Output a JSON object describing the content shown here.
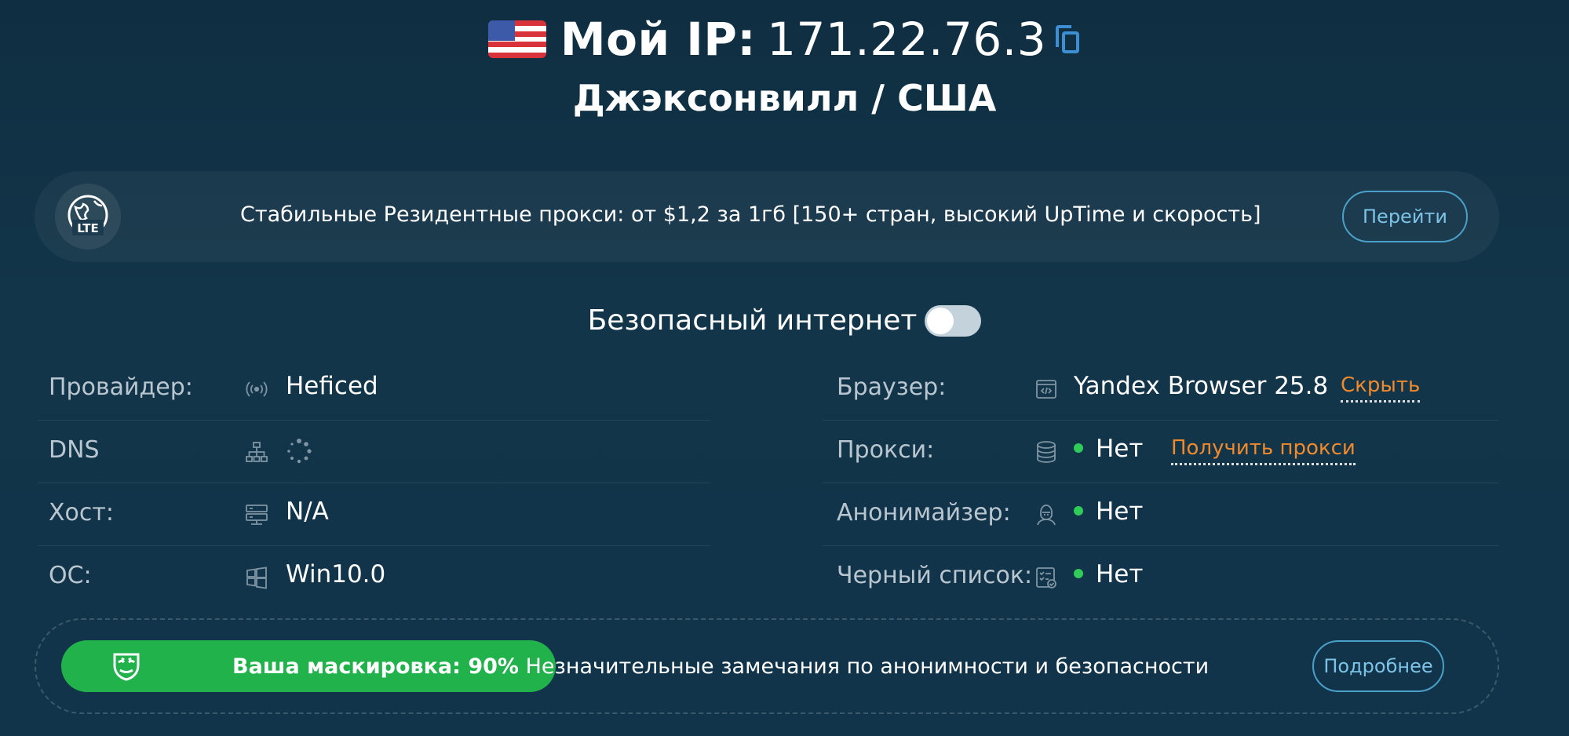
{
  "header": {
    "ip_label": "Мой IP:",
    "ip_value": "171.22.76.3",
    "city": "Джэксонвилл / США"
  },
  "promo": {
    "badge": "LTE",
    "text": "Стабильные Резидентные прокси: от $1,2 за 1гб [150+ стран, высокий UpTime и скорость]",
    "button": "Перейти"
  },
  "safe_internet": {
    "label": "Безопасный интернет",
    "enabled": false
  },
  "left_info": [
    {
      "label": "Провайдер:",
      "value": "Heficed",
      "icon": "signal-icon"
    },
    {
      "label": "DNS",
      "value": "",
      "icon": "network-icon"
    },
    {
      "label": "Хост:",
      "value": "N/A",
      "icon": "server-icon"
    },
    {
      "label": "ОС:",
      "value": "Win10.0",
      "icon": "windows-icon"
    }
  ],
  "right_info": [
    {
      "label": "Браузер:",
      "value": "Yandex Browser 25.8",
      "icon": "browser-code-icon",
      "link": "Скрыть"
    },
    {
      "label": "Прокси:",
      "value": "Нет",
      "icon": "database-icon",
      "link": "Получить прокси"
    },
    {
      "label": "Анонимайзер:",
      "value": "Нет",
      "icon": "hacker-icon"
    },
    {
      "label": "Черный список:",
      "value": "Нет",
      "icon": "checklist-icon"
    }
  ],
  "masking": {
    "label": "Ваша маскировка: 90%",
    "percent": 90,
    "description": "Незначительные замечания по анонимности и безопасности",
    "button": "Подробнее"
  },
  "colors": {
    "accent_green": "#22b24c",
    "status_dot": "#2fcc5a",
    "link_orange": "#f08a2c",
    "button_border": "#4aa0c8"
  }
}
